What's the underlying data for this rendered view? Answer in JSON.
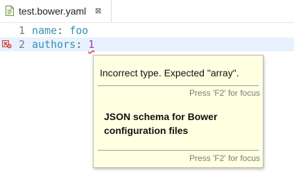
{
  "tab": {
    "title": "test.bower.yaml",
    "close_glyph": "⊠",
    "icon": "yaml-file-icon"
  },
  "editor": {
    "lines": [
      {
        "number": "1",
        "key": "name",
        "colon": ":",
        "value": "foo",
        "has_error": false
      },
      {
        "number": "2",
        "key": "authors",
        "colon": ":",
        "value": "1",
        "has_error": true
      }
    ],
    "error_marker_icon": "error-marker-icon"
  },
  "popup": {
    "message": "Incorrect type. Expected \"array\".",
    "hint_top": "Press 'F2' for focus",
    "schema_title": "JSON schema for Bower configuration files",
    "hint_bottom": "Press 'F2' for focus"
  },
  "colors": {
    "key": "#3a8fb2",
    "number": "#9a3ac7",
    "error": "#d32f2f",
    "current_line": "#e8f2fe",
    "popup_bg": "#ffffe1"
  }
}
